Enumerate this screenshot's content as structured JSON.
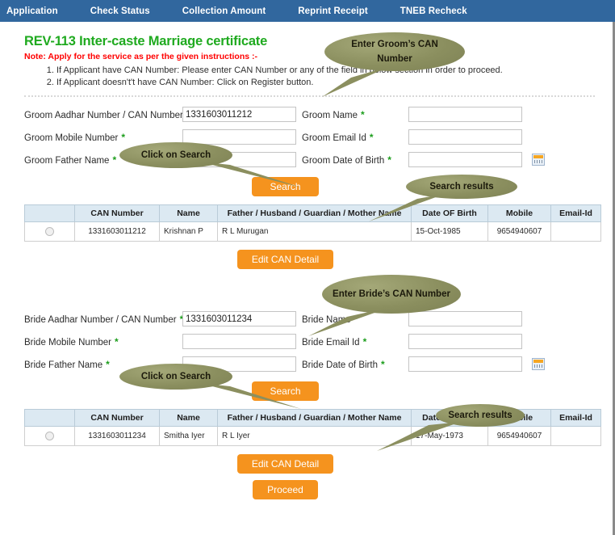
{
  "navbar": {
    "items": [
      {
        "label": "Application"
      },
      {
        "label": "Check Status"
      },
      {
        "label": "Collection Amount"
      },
      {
        "label": "Reprint Receipt"
      },
      {
        "label": "TNEB Recheck"
      }
    ],
    "background_color": "#31679e"
  },
  "page": {
    "title": "REV-113 Inter-caste Marriage certificate",
    "title_color": "#1faa1f",
    "note": "Note: Apply for the service as per the given instructions :-",
    "note_color": "#ff0000",
    "instructions": [
      "If Applicant have CAN Number: Please enter CAN Number or any of the field in below section in order to proceed.",
      "If Applicant doesn't't have CAN Number: Click on Register button."
    ]
  },
  "groom_form": {
    "fields": [
      {
        "label": "Groom Aadhar Number / CAN Number",
        "required": "*",
        "value": "1331603011212",
        "placeholder": ""
      },
      {
        "label": "Groom Mobile Number",
        "required": "*",
        "value": "",
        "placeholder": ""
      },
      {
        "label": "Groom Father Name",
        "required": "*",
        "value": "",
        "placeholder": ""
      }
    ],
    "fields_right": [
      {
        "label": "Groom Name",
        "required": "*",
        "value": "",
        "placeholder": ""
      },
      {
        "label": "Groom Email Id",
        "required": "*",
        "value": "",
        "placeholder": ""
      },
      {
        "label": "Groom Date of Birth",
        "required": "*",
        "value": "",
        "placeholder": "",
        "icon": "calendar-icon"
      }
    ],
    "search_label": "Search",
    "edit_label": "Edit CAN Detail"
  },
  "bride_form": {
    "fields": [
      {
        "label": "Bride Aadhar Number / CAN Number",
        "required": "*",
        "value": "1331603011234",
        "placeholder": ""
      },
      {
        "label": "Bride Mobile Number",
        "required": "*",
        "value": "",
        "placeholder": ""
      },
      {
        "label": "Bride Father Name",
        "required": "*",
        "value": "",
        "placeholder": ""
      }
    ],
    "fields_right": [
      {
        "label": "Bride Name",
        "required": "*",
        "value": "",
        "placeholder": ""
      },
      {
        "label": "Bride Email Id",
        "required": "*",
        "value": "",
        "placeholder": ""
      },
      {
        "label": "Bride Date of Birth",
        "required": "*",
        "value": "",
        "placeholder": "",
        "icon": "calendar-icon"
      }
    ],
    "search_label": "Search",
    "edit_label": "Edit CAN Detail"
  },
  "results_table": {
    "columns": [
      "",
      "CAN Number",
      "Name",
      "Father / Husband / Guardian / Mother Name",
      "Date OF Birth",
      "Mobile",
      "Email-Id"
    ],
    "groom_row": {
      "can_number": "1331603011212",
      "name": "Krishnan P",
      "father_name": "R L Murugan",
      "dob": "15-Oct-1985",
      "mobile": "9654940607",
      "email": ""
    },
    "bride_row": {
      "can_number": "1331603011234",
      "name": "Smitha Iyer",
      "father_name": "R L Iyer",
      "dob": "17-May-1973",
      "mobile": "9654940607",
      "email": ""
    }
  },
  "proceed_label": "Proceed",
  "callouts": {
    "groom_can": "Enter Groom’s CAN Number",
    "groom_search": "Click on Search",
    "groom_results": "Search results",
    "bride_can": "Enter Bride’s CAN Number",
    "bride_search": "Click on Search",
    "bride_results": "Search results",
    "fill_color": "#8b8f5f",
    "text_color": "#1c1a0c"
  }
}
